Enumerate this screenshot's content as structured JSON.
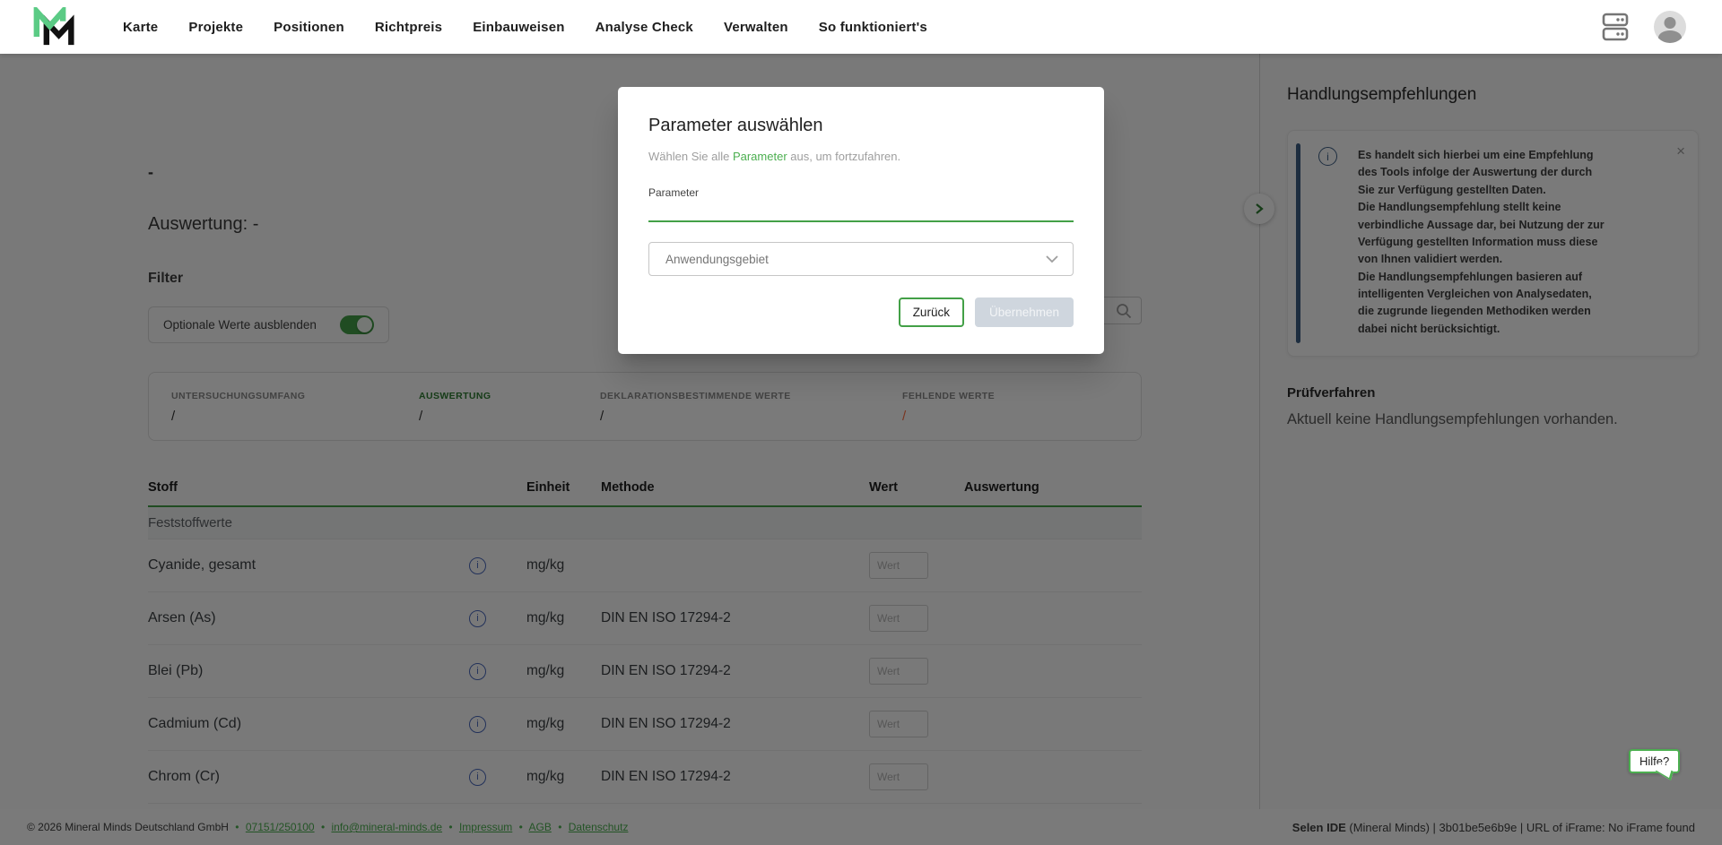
{
  "nav": {
    "items": [
      {
        "label": "Karte"
      },
      {
        "label": "Projekte"
      },
      {
        "label": "Positionen"
      },
      {
        "label": "Richtpreis"
      },
      {
        "label": "Einbauweisen"
      },
      {
        "label": "Analyse Check"
      },
      {
        "label": "Verwalten"
      },
      {
        "label": "So funktioniert's"
      }
    ]
  },
  "modal": {
    "title": "Parameter auswählen",
    "subtitle_prefix": "Wählen Sie alle ",
    "subtitle_link": "Parameter",
    "subtitle_suffix": " aus, um fortzufahren.",
    "field_label": "Parameter",
    "field_value": "",
    "dropdown_value": "Anwendungsgebiet",
    "back_label": "Zurück",
    "apply_label": "Übernehmen"
  },
  "main": {
    "dash": "-",
    "evaluation_title": "Auswertung: -",
    "filter_label": "Filter",
    "toggle_label": "Optionale Werte ausblenden",
    "search_value": "",
    "stats": [
      {
        "label": "UNTERSUCHUNGSUMFANG",
        "value": "/"
      },
      {
        "label": "AUSWERTUNG",
        "value": "/"
      },
      {
        "label": "DEKLARATIONSBESTIMMENDE WERTE",
        "value": "/"
      },
      {
        "label": "FEHLENDE WERTE",
        "value": "/"
      }
    ],
    "table": {
      "headers": [
        "Stoff",
        "Einheit",
        "Methode",
        "Wert",
        "Auswertung"
      ],
      "section_label": "Feststoffwerte",
      "value_placeholder": "Wert",
      "rows": [
        {
          "stoff": "Cyanide, gesamt",
          "einheit": "mg/kg",
          "methode": ""
        },
        {
          "stoff": "Arsen (As)",
          "einheit": "mg/kg",
          "methode": "DIN EN ISO 17294-2"
        },
        {
          "stoff": "Blei (Pb)",
          "einheit": "mg/kg",
          "methode": "DIN EN ISO 17294-2"
        },
        {
          "stoff": "Cadmium (Cd)",
          "einheit": "mg/kg",
          "methode": "DIN EN ISO 17294-2"
        },
        {
          "stoff": "Chrom (Cr)",
          "einheit": "mg/kg",
          "methode": "DIN EN ISO 17294-2"
        }
      ]
    }
  },
  "sidebar": {
    "title": "Handlungsempfehlungen",
    "notice": [
      "Es handelt sich hierbei um eine Empfehlung des Tools infolge der Auswertung der durch Sie zur Verfügung gestellten Daten.",
      "Die Handlungsempfehlung stellt keine verbindliche Aussage dar, bei Nutzung der zur Verfügung gestellten Information muss diese von Ihnen validiert werden.",
      "Die Handlungsempfehlungen basieren auf intelligenten Vergleichen von Analysedaten, die zugrunde liegenden Methodiken werden dabei nicht berücksichtigt."
    ],
    "close_icon": "×",
    "pruefverfahren_title": "Prüfverfahren",
    "pruefverfahren_text": "Aktuell keine Handlungsempfehlungen vorhanden.",
    "help_label": "Hilfe?"
  },
  "footer": {
    "copyright": "© 2026 Mineral Minds Deutschland GmbH",
    "phone": "07151/250100",
    "email": "info@mineral-minds.de",
    "links": [
      {
        "label": "Impressum"
      },
      {
        "label": "AGB"
      },
      {
        "label": "Datenschutz"
      }
    ],
    "right_bold": "Selen IDE",
    "right_rest": " (Mineral Minds) | 3b01be5e6b9e | URL of iFrame: No iFrame found"
  },
  "colors": {
    "brand_green": "#43a047",
    "link_green": "#4caf50",
    "logo_mint": "#5bcb85",
    "info_blue": "#4a69bd",
    "sidebar_blue": "#3d5f85",
    "missing_orange": "#ff7043"
  }
}
